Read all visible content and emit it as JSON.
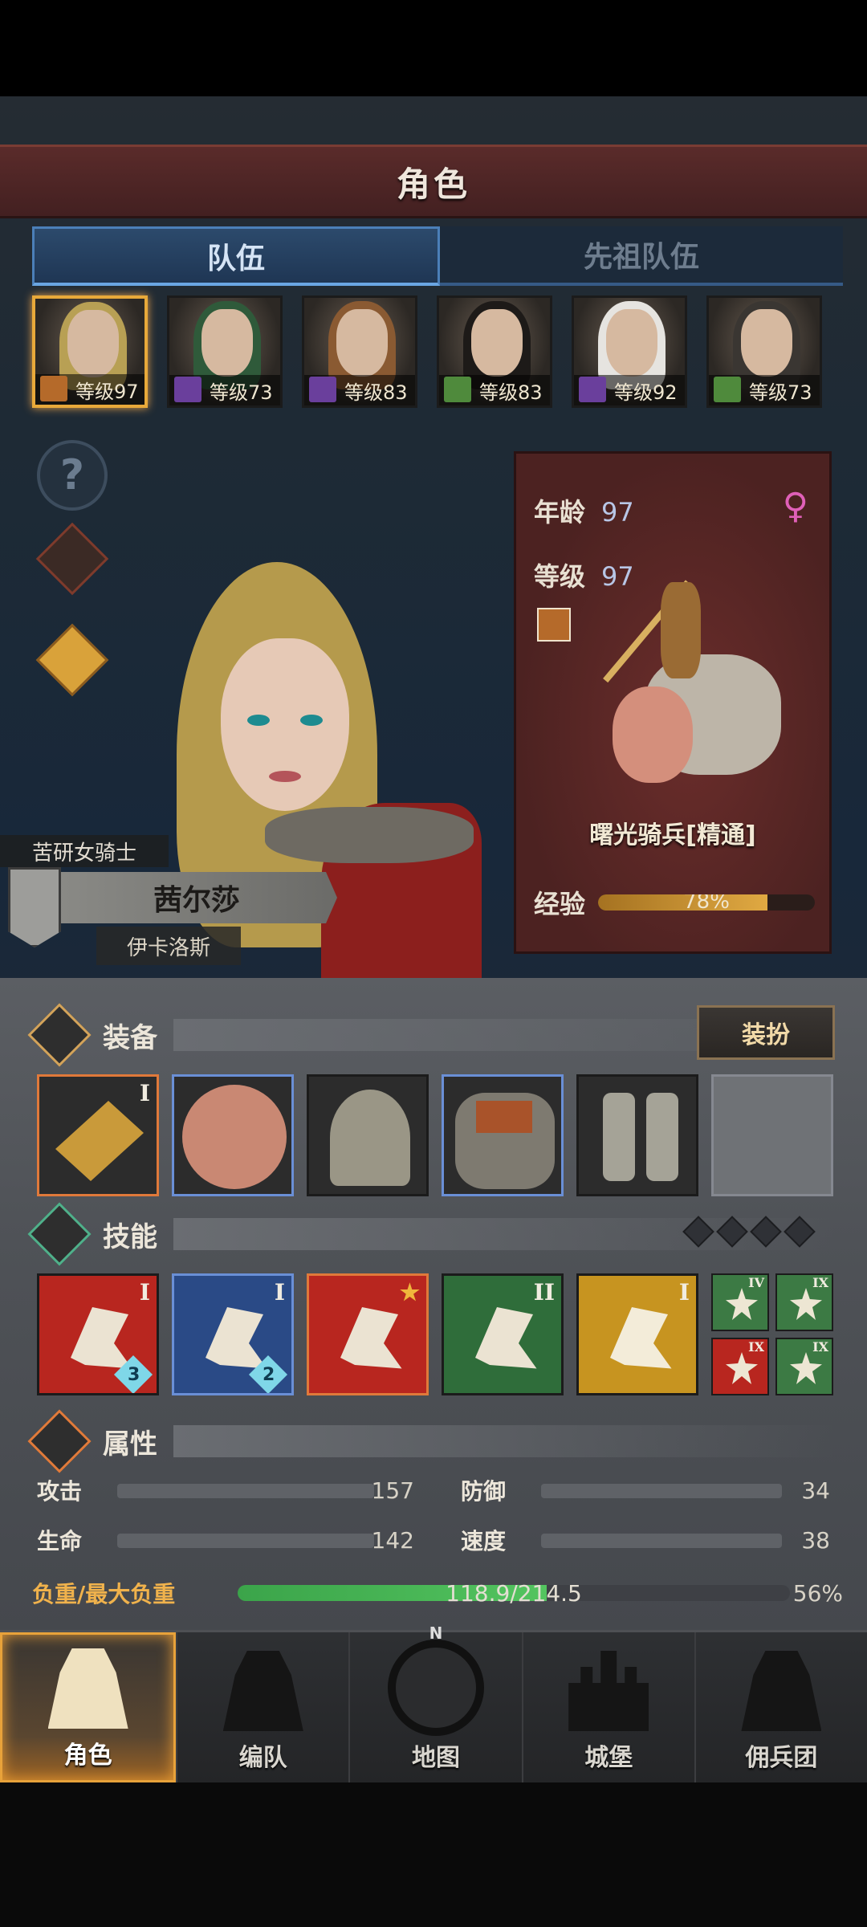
{
  "header": {
    "title": "角色"
  },
  "tabs": [
    {
      "label": "队伍",
      "active": true
    },
    {
      "label": "先祖队伍",
      "active": false
    }
  ],
  "party": [
    {
      "level_text": "等级97",
      "class": "cavalry",
      "hair": "#b8a054",
      "selected": true
    },
    {
      "level_text": "等级73",
      "class": "mage",
      "hair": "#2f5a3a",
      "selected": false
    },
    {
      "level_text": "等级83",
      "class": "mage",
      "hair": "#8a5a32",
      "selected": false
    },
    {
      "level_text": "等级83",
      "class": "archer",
      "hair": "#1d1a18",
      "selected": false
    },
    {
      "level_text": "等级92",
      "class": "mage",
      "hair": "#e6e4e0",
      "selected": false
    },
    {
      "level_text": "等级73",
      "class": "archer",
      "hair": "#3a3632",
      "selected": false
    }
  ],
  "side_icons": {
    "help": "?"
  },
  "hero": {
    "title": "苦研女骑士",
    "name": "茜尔莎",
    "house": "伊卡洛斯"
  },
  "info": {
    "age_label": "年龄",
    "age": "97",
    "level_label": "等级",
    "level": "97",
    "sex_icon": "♀",
    "unit_name": "曙光骑兵[精通]",
    "exp_label": "经验",
    "exp_percent": 78,
    "exp_text": "78%"
  },
  "equipment": {
    "label": "装备",
    "outfit_button": "装扮",
    "slots": [
      {
        "item": "weapon-icon",
        "roman": "I",
        "rarity": "orange"
      },
      {
        "item": "shield-icon",
        "roman": "",
        "rarity": "blue"
      },
      {
        "item": "helmet-icon",
        "roman": "",
        "rarity": "none"
      },
      {
        "item": "armor-icon",
        "roman": "",
        "rarity": "blue"
      },
      {
        "item": "boots-icon",
        "roman": "",
        "rarity": "none"
      },
      {
        "item": "ring-slot-icon",
        "roman": "",
        "rarity": "empty"
      }
    ]
  },
  "skills": {
    "label": "技能",
    "items": [
      {
        "color": "red",
        "roman": "I",
        "level": "3"
      },
      {
        "color": "blue",
        "roman": "I",
        "level": "2"
      },
      {
        "color": "red",
        "roman": "★",
        "level": ""
      },
      {
        "color": "green",
        "roman": "II",
        "level": ""
      },
      {
        "color": "gold",
        "roman": "I",
        "level": ""
      }
    ],
    "minis": [
      {
        "color": "g",
        "roman": "IV"
      },
      {
        "color": "g",
        "roman": "IX"
      },
      {
        "color": "r",
        "roman": "IX"
      },
      {
        "color": "g",
        "roman": "IX"
      }
    ]
  },
  "attributes": {
    "label": "属性",
    "attack_label": "攻击",
    "attack": "157",
    "defense_label": "防御",
    "defense": "34",
    "hp_label": "生命",
    "hp": "142",
    "speed_label": "速度",
    "speed": "38",
    "load_label": "负重/最大负重",
    "load_text": "118.9/214.5",
    "load_percent": 56,
    "load_pct_text": "56%"
  },
  "nav": [
    {
      "label": "角色",
      "active": true
    },
    {
      "label": "编队",
      "active": false
    },
    {
      "label": "地图",
      "active": false,
      "compass_n": "N"
    },
    {
      "label": "城堡",
      "active": false
    },
    {
      "label": "佣兵团",
      "active": false
    }
  ]
}
